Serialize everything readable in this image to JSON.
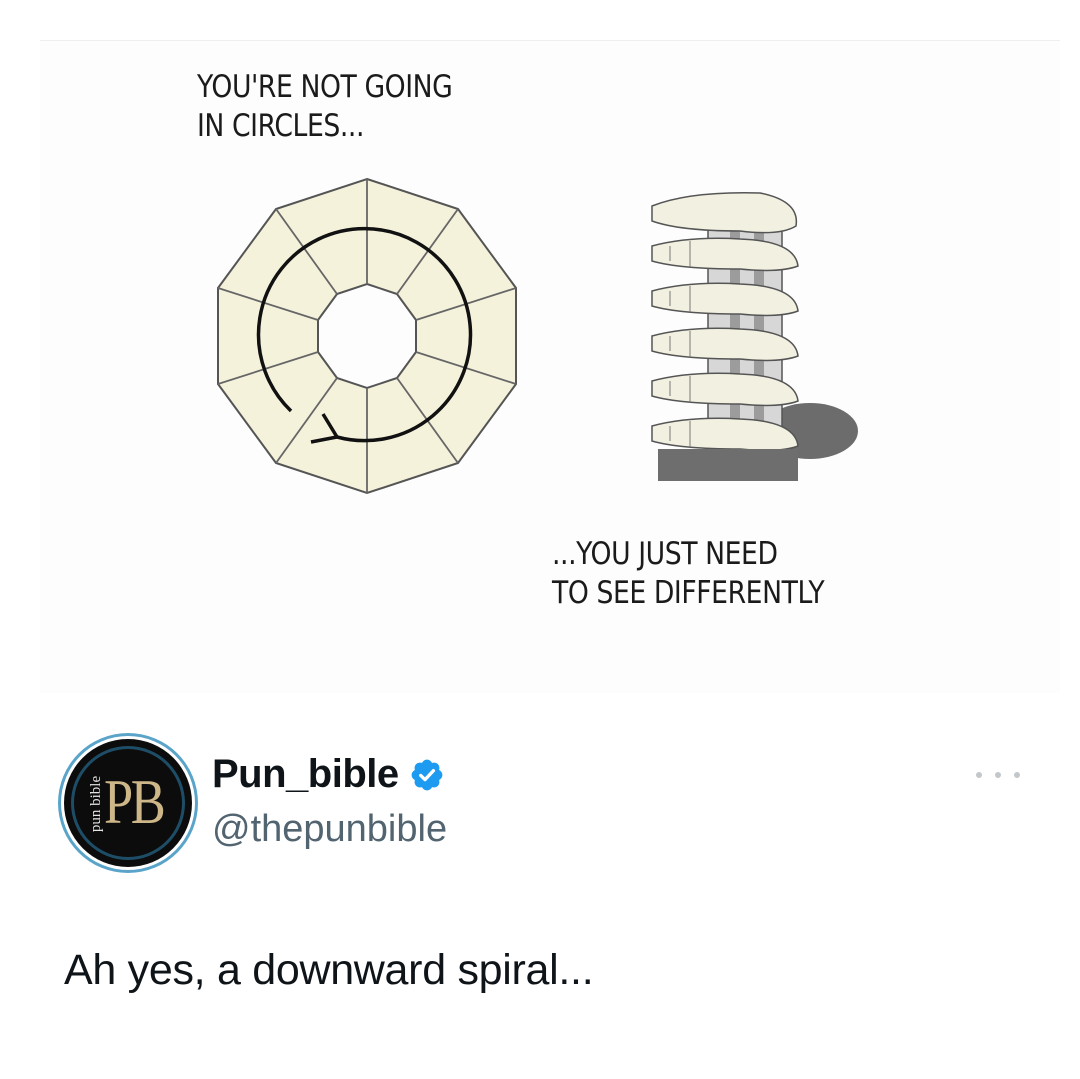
{
  "comic": {
    "caption_top": "YOU'RE NOT GOING\nIN CIRCLES...",
    "caption_bottom": "...YOU JUST NEED\nTO SEE DIFFERENTLY"
  },
  "author": {
    "avatar_text": "PB",
    "avatar_side_text": "pun bible",
    "display_name": "Pun_bible",
    "handle": "@thepunbible",
    "verified_color": "#1d9bf0"
  },
  "post": {
    "text": "Ah yes, a downward spiral..."
  },
  "icons": {
    "more": "more-options-icon",
    "verified": "verified-badge-icon"
  }
}
